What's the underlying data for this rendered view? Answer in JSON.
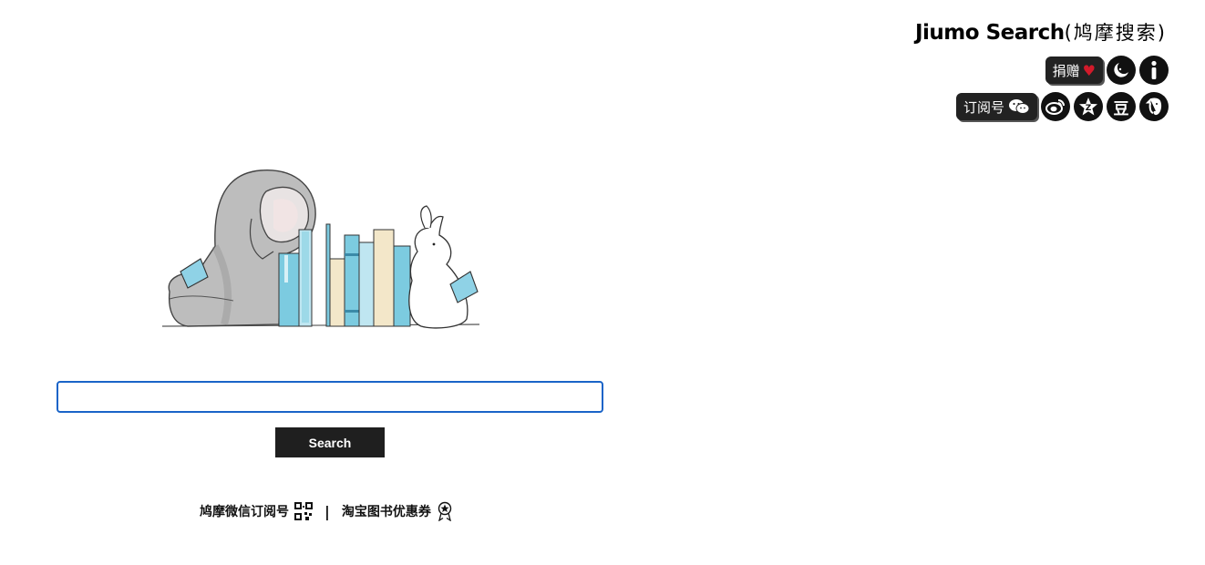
{
  "header": {
    "brand_en": "Jiumo Search",
    "brand_cn": "(鸠摩搜索)",
    "donate_label": "捐赠",
    "subscribe_label": "订阅号",
    "douban_label": "豆"
  },
  "icons": {
    "donate_heart": "heart-icon",
    "night_mode": "moon-icon",
    "info": "info-icon",
    "wechat": "wechat-icon",
    "weibo": "weibo-icon",
    "zhihu_star": "star-icon",
    "douban": "douban-icon",
    "evernote": "elephant-icon",
    "qrcode": "qrcode-icon",
    "coupon": "coupon-icon"
  },
  "search": {
    "value": "",
    "placeholder": "",
    "button_label": "Search"
  },
  "footer": {
    "wechat_link": "鸠摩微信订阅号",
    "separator": "|",
    "taobao_link": "淘宝图书优惠券"
  },
  "colors": {
    "accent_border": "#1a64c8",
    "button_bg": "#1f1f1f",
    "heart": "#d21a2a",
    "book_blue": "#7ccbe0",
    "book_cream": "#f3e7c9"
  }
}
